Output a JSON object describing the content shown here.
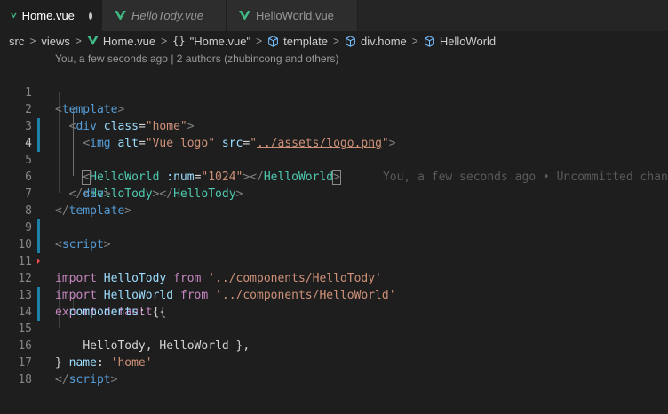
{
  "tabs": [
    {
      "label": "Home.vue",
      "active": true,
      "dirty": true,
      "italic": false
    },
    {
      "label": "HelloTody.vue",
      "active": false,
      "dirty": false,
      "italic": true
    },
    {
      "label": "HelloWorld.vue",
      "active": false,
      "dirty": false,
      "italic": false
    }
  ],
  "breadcrumb": {
    "items": [
      "src",
      "views",
      "Home.vue",
      "\"Home.vue\"",
      "template",
      "div.home",
      "HelloWorld"
    ],
    "braces": "{}"
  },
  "codelens": "You, a few seconds ago | 2 authors (zhubincong and others)",
  "inline_blame": "You, a few seconds ago • Uncommitted changes",
  "line_numbers": [
    "1",
    "2",
    "3",
    "4",
    "5",
    "6",
    "7",
    "8",
    "9",
    "10",
    "11",
    "12",
    "13",
    "14",
    "15",
    "16",
    "17",
    "18"
  ],
  "code": {
    "l1": {
      "open": "<",
      "tag": "template",
      "close": ">"
    },
    "l2": {
      "open": "<",
      "tag": "div",
      "attr": "class",
      "eq": "=",
      "val": "\"home\"",
      "close": ">"
    },
    "l3": {
      "open": "<",
      "tag": "img",
      "attr1": "alt",
      "val1": "\"Vue logo\"",
      "attr2": "src",
      "val2a": "\"",
      "val2b": "../assets/logo.png",
      "val2c": "\"",
      "close": ">"
    },
    "l4": {
      "open": "<",
      "tag": "HelloWorld",
      "attr": ":num",
      "eq": "=",
      "val": "\"1024\"",
      "close": ">",
      "endopen": "</",
      "endtag": "HelloWorld",
      "endclose": ">"
    },
    "l5": {
      "open": "<",
      "tag": "HelloTody",
      "close": ">",
      "endopen": "</",
      "endtag": "HelloTody",
      "endclose": ">"
    },
    "l6": {
      "endopen": "</",
      "endtag": "div",
      "endclose": ">"
    },
    "l7": {
      "endopen": "</",
      "endtag": "template",
      "endclose": ">"
    },
    "l9": {
      "open": "<",
      "tag": "script",
      "close": ">"
    },
    "l10": {
      "kw": "import",
      "name": "HelloTody",
      "from": "from",
      "path": "'../components/HelloTody'"
    },
    "l11": {
      "kw": "import",
      "name": "HelloWorld",
      "from": "from",
      "path": "'../components/HelloWorld'"
    },
    "l12": {
      "kw1": "export",
      "kw2": "default",
      "brace": "{"
    },
    "l13": {
      "prop": "components",
      "rest": ": {"
    },
    "l14": {
      "text": "HelloTody, HelloWorld },"
    },
    "l15": {
      "prop": "name",
      "colon": ": ",
      "val": "'home'"
    },
    "l16": {
      "text": "}"
    },
    "l17": {
      "endopen": "</",
      "endtag": "script",
      "endclose": ">"
    }
  },
  "colors": {
    "background": "#1e1e1e",
    "tag": "#569cd6",
    "component": "#4ec9b0",
    "attribute": "#9cdcfe",
    "string": "#ce9178",
    "keyword": "#c586c0",
    "vue_icon": "#41b883",
    "modified_gutter": "#1b81a8"
  }
}
